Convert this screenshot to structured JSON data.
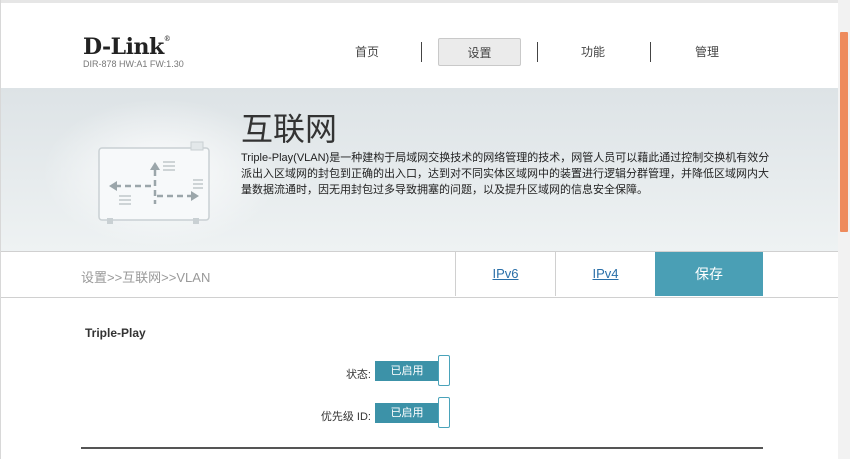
{
  "header": {
    "brand": "D-Link",
    "brand_mark": "®",
    "model": "DIR-878 HW:A1 FW:1.30",
    "nav": [
      {
        "label": "首页",
        "active": false
      },
      {
        "label": "设置",
        "active": true
      },
      {
        "label": "功能",
        "active": false
      },
      {
        "label": "管理",
        "active": false
      }
    ]
  },
  "banner": {
    "title": "互联网",
    "description": "Triple-Play(VLAN)是一种建构于局域网交换技术的网络管理的技术，网管人员可以藉此通过控制交换机有效分派出入区域网的封包到正确的出入口，达到对不同实体区域网中的装置进行逻辑分群管理，并降低区域网内大量数据流通时，因无用封包过多导致拥塞的问题，以及提升区域网的信息安全保障。",
    "illustration": "network-vlan-diagram-icon"
  },
  "toolbar": {
    "breadcrumb": "设置>>互联网>>VLAN",
    "ipv6_label": "IPv6",
    "ipv4_label": "IPv4",
    "save_label": "保存"
  },
  "triple_play": {
    "section_title": "Triple-Play",
    "status_label": "状态:",
    "status_value": "已启用",
    "priority_label": "优先级 ID:",
    "priority_value": "已启用"
  },
  "colors": {
    "accent": "#4a9fb5",
    "toggle_on": "#3c92a8",
    "link": "#2a6fa8",
    "scroll_thumb": "#ee8a5c"
  }
}
